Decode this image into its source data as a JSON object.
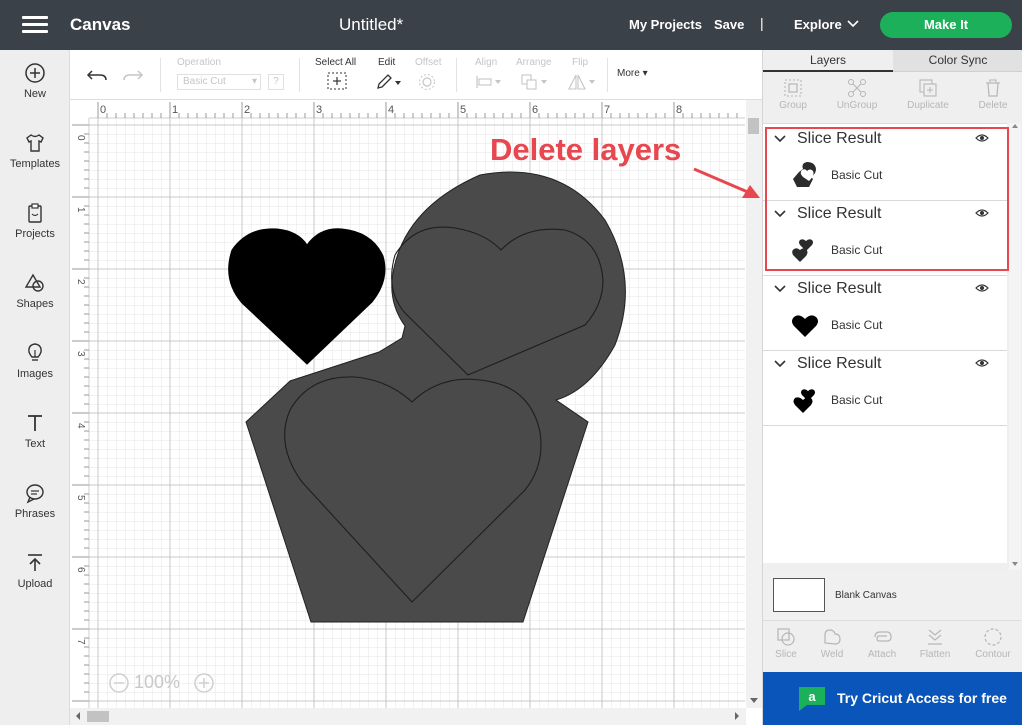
{
  "topbar": {
    "app_title": "Canvas",
    "doc_title": "Untitled*",
    "my_projects": "My Projects",
    "save": "Save",
    "separator": "|",
    "explore": "Explore",
    "make_it": "Make It",
    "make_it_color": "#1db05b",
    "bar_color": "#3b4148"
  },
  "leftnav": {
    "items": [
      {
        "label": "New",
        "icon": "plus-circle-icon"
      },
      {
        "label": "Templates",
        "icon": "tshirt-icon"
      },
      {
        "label": "Projects",
        "icon": "clipboard-icon"
      },
      {
        "label": "Shapes",
        "icon": "shapes-icon"
      },
      {
        "label": "Images",
        "icon": "lightbulb-icon"
      },
      {
        "label": "Text",
        "icon": "text-icon"
      },
      {
        "label": "Phrases",
        "icon": "speech-bubble-icon"
      },
      {
        "label": "Upload",
        "icon": "upload-icon"
      }
    ]
  },
  "toolbar": {
    "operation_label": "Operation",
    "operation_value": "Basic Cut",
    "operation_help": "?",
    "select_all": "Select All",
    "edit": "Edit",
    "offset": "Offset",
    "align": "Align",
    "arrange": "Arrange",
    "flip": "Flip",
    "more": "More"
  },
  "canvas": {
    "ruler_top": [
      "0",
      "1",
      "2",
      "3",
      "4",
      "5",
      "6",
      "7",
      "8"
    ],
    "ruler_left": [
      "0",
      "1",
      "2",
      "3",
      "4",
      "5",
      "6",
      "7",
      "8"
    ],
    "zoom": "100%",
    "shape_fill": "#4a4a4a",
    "heart_fill": "#000000"
  },
  "rightpanel": {
    "tabs": [
      "Layers",
      "Color Sync"
    ],
    "tools": [
      "Group",
      "UnGroup",
      "Duplicate",
      "Delete"
    ],
    "layers": [
      {
        "title": "Slice Result",
        "sub": "Basic Cut",
        "thumb": "cut-heart-thumb-icon"
      },
      {
        "title": "Slice Result",
        "sub": "Basic Cut",
        "thumb": "two-hearts-thumb-icon"
      },
      {
        "title": "Slice Result",
        "sub": "Basic Cut",
        "thumb": "heart-thumb-icon"
      },
      {
        "title": "Slice Result",
        "sub": "Basic Cut",
        "thumb": "stacked-hearts-thumb-icon"
      }
    ],
    "blank_canvas": "Blank Canvas",
    "bottom_tools": [
      "Slice",
      "Weld",
      "Attach",
      "Flatten",
      "Contour"
    ],
    "access": "Try Cricut Access for free",
    "access_color": "#0a55b9"
  },
  "annotation": {
    "text": "Delete layers",
    "color": "#e8474f"
  }
}
